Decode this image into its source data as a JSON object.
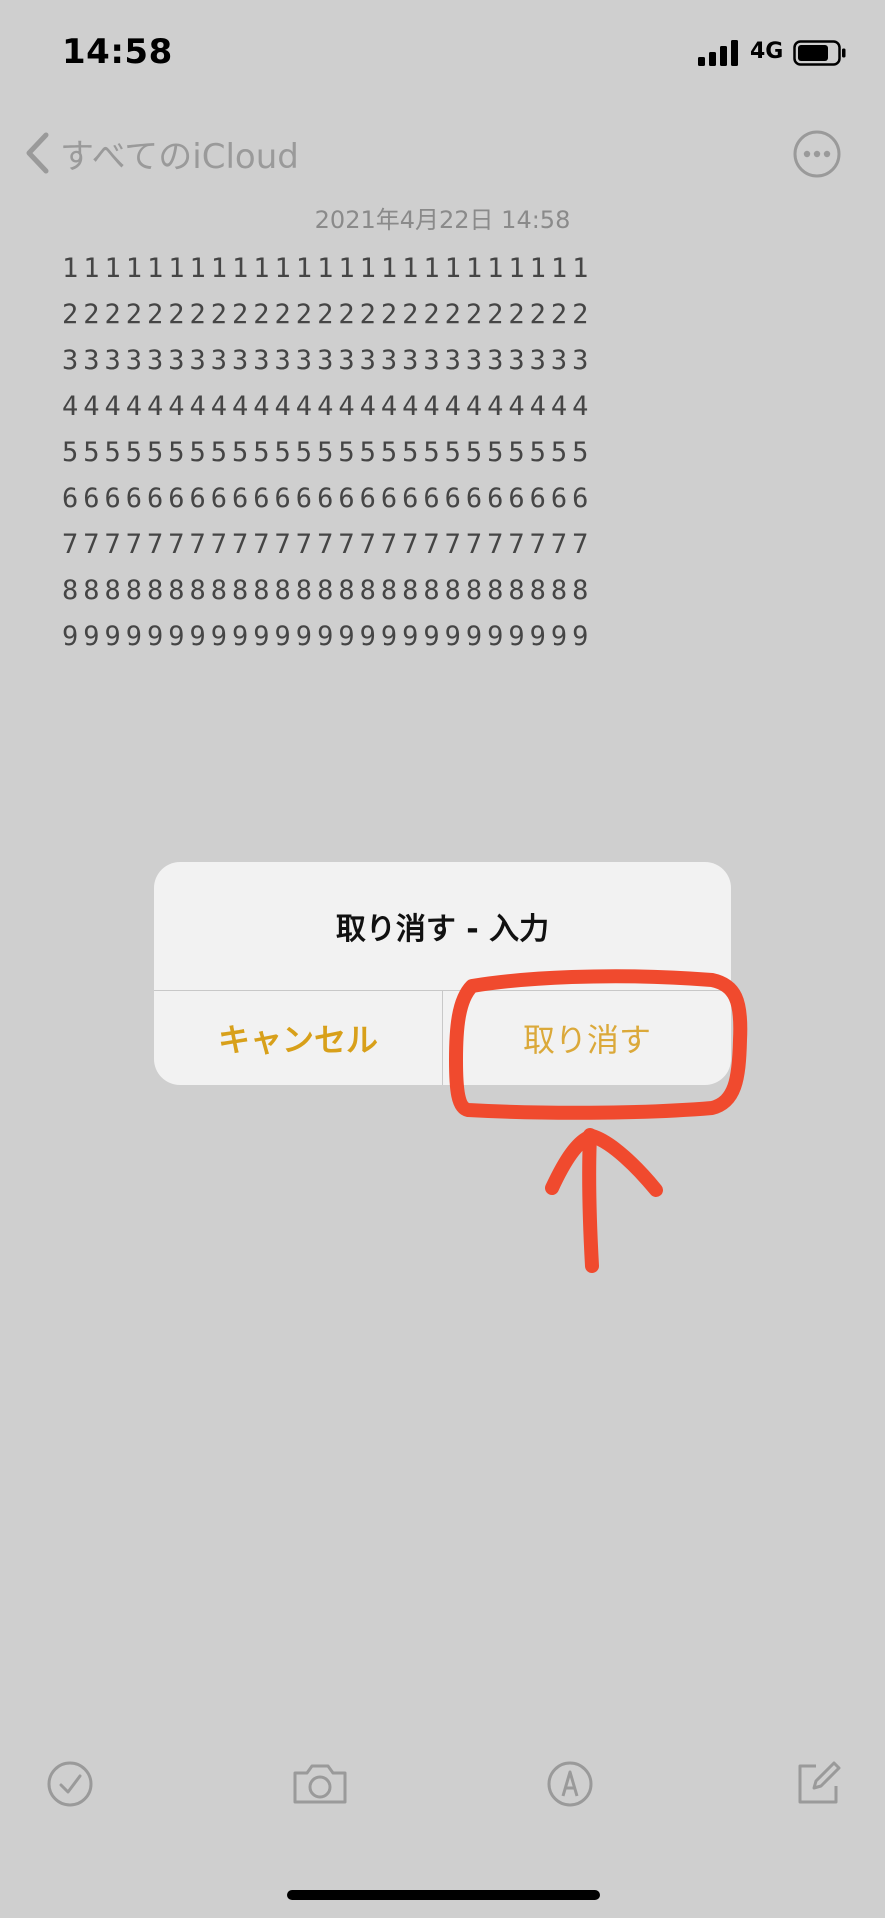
{
  "status_bar": {
    "time": "14:58",
    "network": "4G"
  },
  "nav": {
    "back_label": "すべてのiCloud"
  },
  "note": {
    "date": "2021年4月22日 14:58",
    "lines": [
      "1111111111111111111111111",
      "2222222222222222222222222",
      "3333333333333333333333333",
      "4444444444444444444444444",
      "5555555555555555555555555",
      "6666666666666666666666666",
      "7777777777777777777777777",
      "8888888888888888888888888",
      "9999999999999999999999999"
    ]
  },
  "alert": {
    "title": "取り消す - 入力",
    "cancel_label": "キャンセル",
    "undo_label": "取り消す"
  },
  "annotation": {
    "color": "#f04a2e"
  },
  "toolbar": {
    "icons": [
      "checklist-icon",
      "camera-icon",
      "markup-pen-icon",
      "compose-icon"
    ]
  },
  "colors": {
    "accent": "#d9a21c",
    "background": "#cfcfcf"
  }
}
